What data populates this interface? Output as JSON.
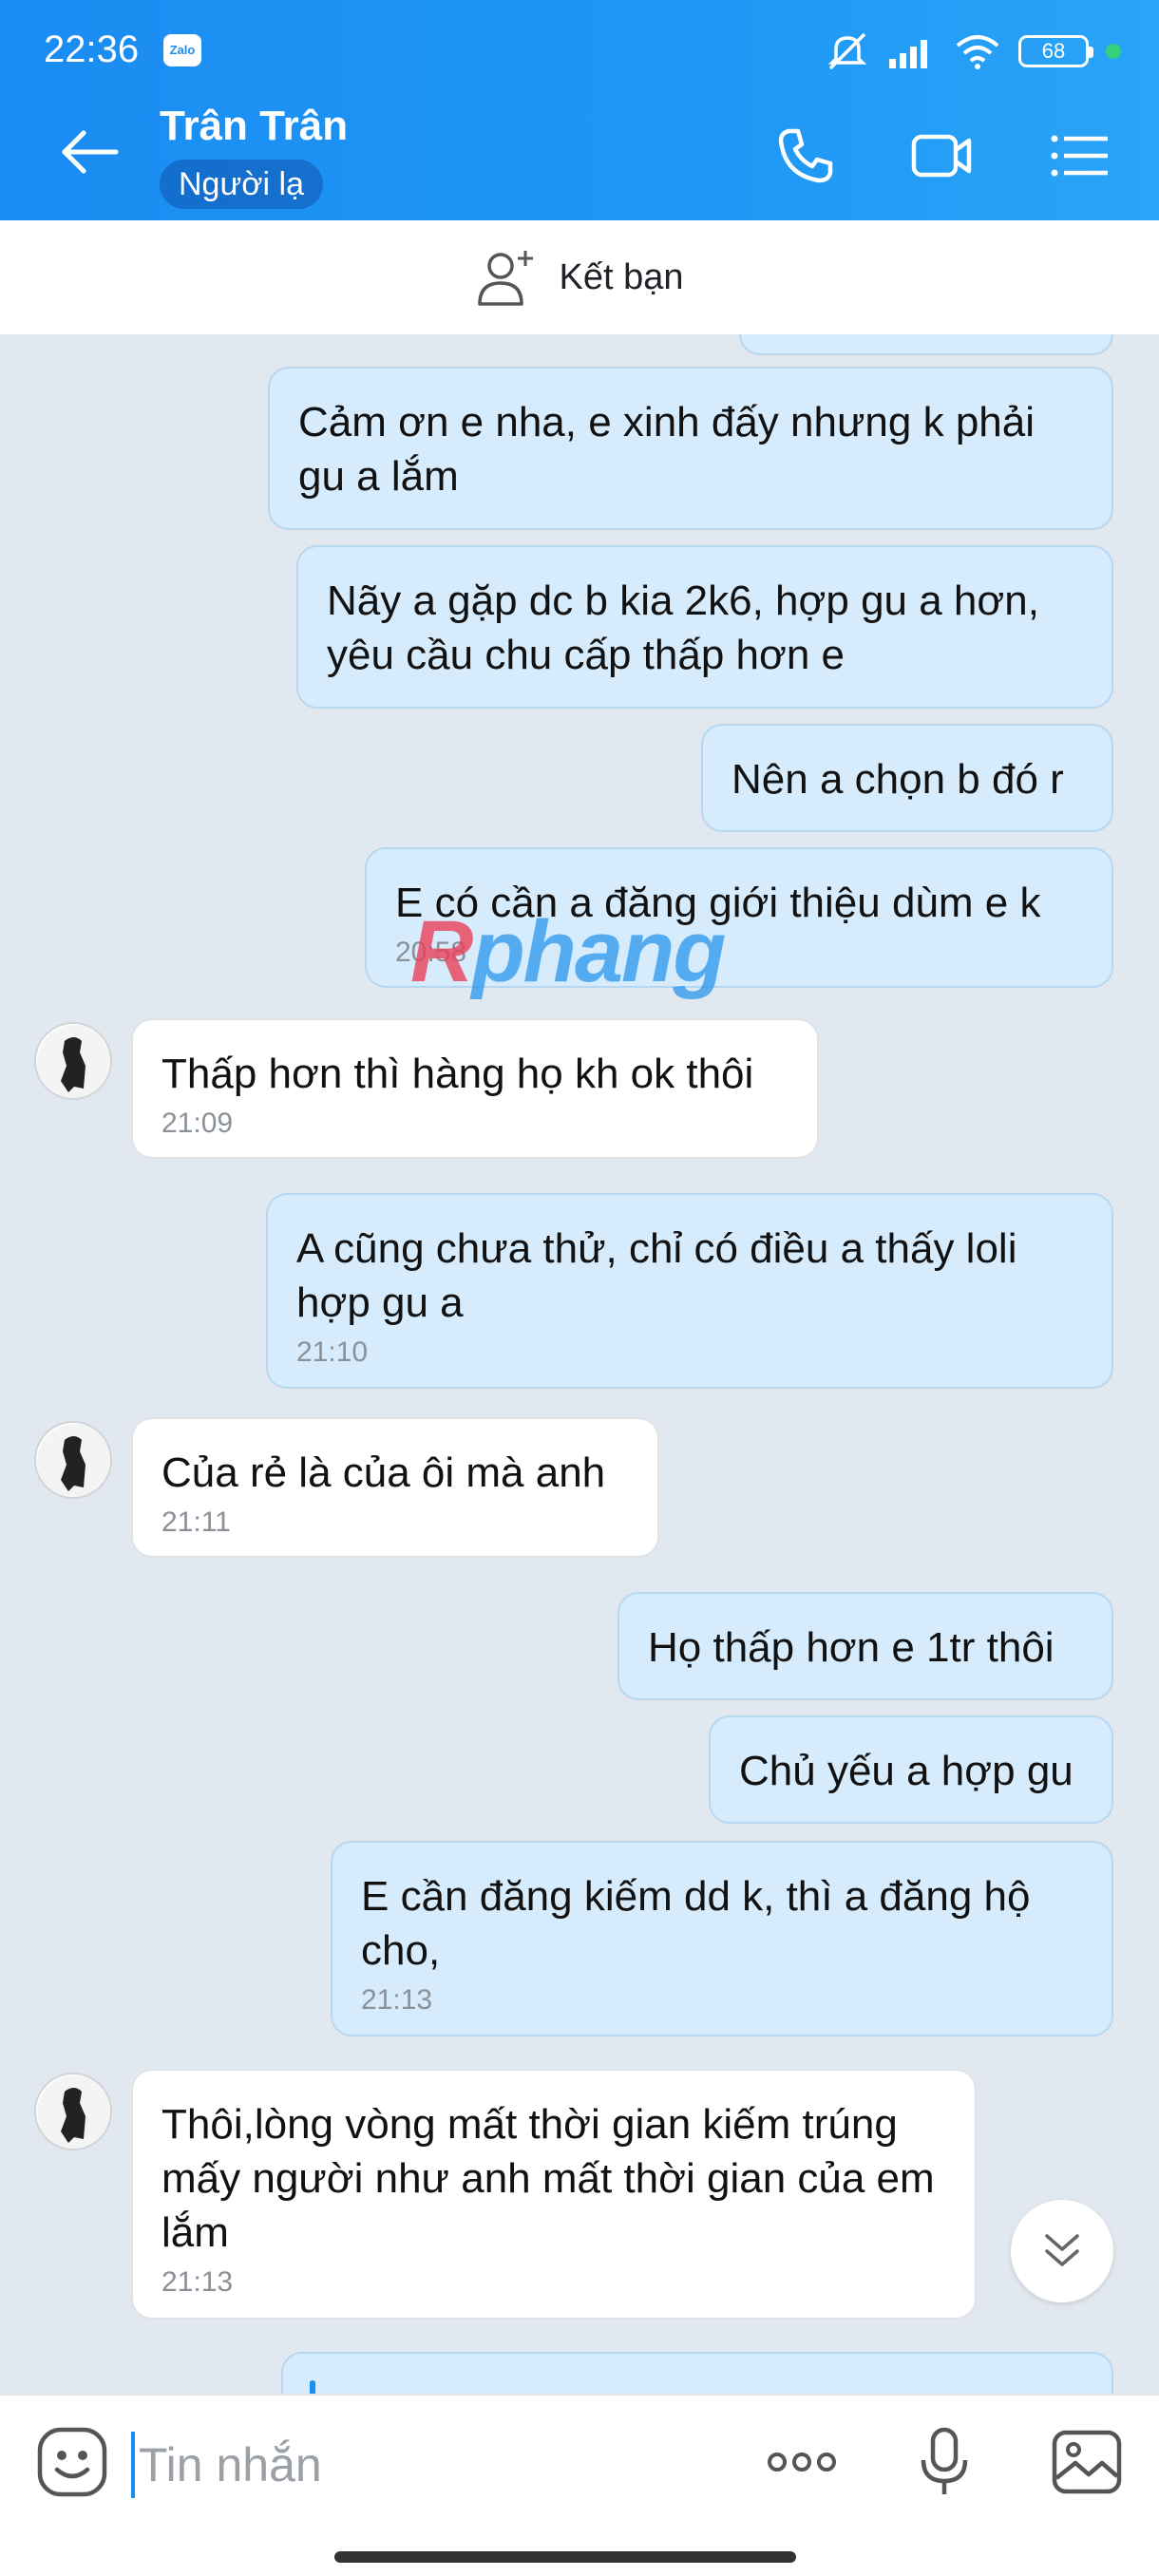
{
  "status_bar": {
    "time": "22:36",
    "app_badge": "Zalo",
    "battery": "68"
  },
  "header": {
    "contact_name": "Trân Trân",
    "contact_tag": "Người lạ"
  },
  "friend_bar": {
    "label": "Kết bạn"
  },
  "messages": [
    {
      "dir": "out",
      "text": "Cảm ơn e nha, e xinh đấy nhưng k phải gu a lắm",
      "time": ""
    },
    {
      "dir": "out",
      "text": "Nãy a gặp dc b kia 2k6, hợp gu a hơn, yêu cầu chu cấp thấp hơn e",
      "time": ""
    },
    {
      "dir": "out",
      "text": "Nên a chọn b đó r",
      "time": ""
    },
    {
      "dir": "out",
      "text": "E có cần a đăng giới thiệu dùm e k",
      "time": "20:58"
    },
    {
      "dir": "in",
      "text": "Thấp hơn thì hàng họ kh ok thôi",
      "time": "21:09"
    },
    {
      "dir": "out",
      "text": "A cũng chưa thử, chỉ có điều a thấy loli hợp gu a",
      "time": "21:10"
    },
    {
      "dir": "in",
      "text": "Của rẻ là của ôi mà anh",
      "time": "21:11"
    },
    {
      "dir": "out",
      "text": "Họ thấp hơn e 1tr thôi",
      "time": ""
    },
    {
      "dir": "out",
      "text": "Chủ yếu a hợp gu",
      "time": ""
    },
    {
      "dir": "out",
      "text": "E cần đăng kiếm dd k, thì a đăng hộ cho,",
      "time": "21:13"
    },
    {
      "dir": "in",
      "text": "Thôi,lòng vòng mất thời gian kiếm trúng mấy người như anh mất thời gian của em lắm",
      "time": "21:13"
    }
  ],
  "watermark": {
    "prefix": "R",
    "rest": "phang"
  },
  "input": {
    "placeholder": "Tin nhắn"
  },
  "icons": {
    "back": "arrow-left-icon",
    "call": "phone-icon",
    "video": "video-camera-icon",
    "menu": "list-menu-icon",
    "add_friend": "user-plus-icon",
    "emoji": "emoji-icon",
    "more": "more-dots-icon",
    "mic": "microphone-icon",
    "gallery": "image-gallery-icon",
    "scroll_down": "double-chevron-down-icon"
  },
  "colors": {
    "header": "#1b8cf2",
    "outgoing_bubble": "#d6ecfd",
    "incoming_bubble": "#ffffff",
    "chat_bg": "#e2e8ef"
  }
}
